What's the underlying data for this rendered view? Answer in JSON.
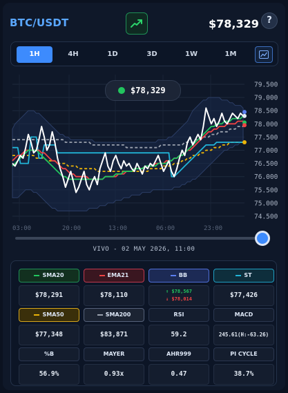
{
  "header": {
    "pair": "BTC/USDT",
    "price": "$78,329",
    "help": "?"
  },
  "timeframes": [
    "1H",
    "4H",
    "1D",
    "3D",
    "1W",
    "1M"
  ],
  "active_timeframe": "1H",
  "chart": {
    "pill_price": "$78,329",
    "live_label": "VIVO - 02 MAY 2026, 11:00"
  },
  "colors": {
    "price": "#ffffff",
    "sma20": "#22c55e",
    "ema21": "#ef4444",
    "sma50": "#eab308",
    "sma200": "#9ca3af",
    "supertrend": "#22b5d8",
    "bb_band": "#1a2a4a"
  },
  "chart_data": {
    "type": "line",
    "x_tick_labels": [
      "03:00",
      "20:00",
      "13:00",
      "06:00",
      "23:00"
    ],
    "y_tick_labels": [
      "79.500",
      "79.000",
      "78.500",
      "78.000",
      "77.500",
      "77.000",
      "76.500",
      "76.000",
      "75.500",
      "75.000",
      "74.500"
    ],
    "ylim": [
      74500,
      79500
    ],
    "grid": true,
    "series": [
      {
        "name": "",
        "color": "#ffffff",
        "values": [
          76.5,
          76.4,
          76.6,
          76.8,
          76.7,
          77.1,
          77.6,
          77.3,
          76.9,
          77.0,
          77.4,
          77.9,
          77.5,
          77.0,
          77.2,
          77.7,
          77.3,
          76.7,
          76.3,
          76.0,
          75.6,
          75.9,
          76.2,
          75.8,
          75.4,
          75.6,
          75.9,
          76.2,
          75.7,
          75.5,
          75.8,
          76.0,
          75.7,
          76.3,
          76.6,
          76.9,
          76.4,
          76.2,
          76.6,
          76.8,
          76.5,
          76.3,
          76.6,
          76.4,
          76.5,
          76.3,
          76.2,
          76.5,
          76.3,
          76.1,
          76.4,
          76.3,
          76.5,
          76.4,
          76.6,
          76.8,
          76.5,
          76.2,
          76.4,
          76.6,
          76.2,
          76.0,
          76.3,
          76.7,
          77.0,
          76.8,
          77.3,
          77.5,
          77.2,
          77.4,
          77.6,
          77.4,
          77.9,
          78.6,
          78.3,
          78.0,
          78.2,
          77.9,
          78.1,
          78.4,
          78.1,
          78.0,
          78.2,
          78.4,
          78.3,
          78.2,
          78.4,
          78.3
        ]
      },
      {
        "name": "",
        "color": "#22b5d8",
        "values": [
          77.1,
          77.1,
          77.1,
          76.5,
          76.5,
          76.5,
          76.5,
          77.5,
          77.5,
          77.5,
          76.7,
          76.7,
          77.2,
          77.2,
          77.2,
          77.2,
          77.2,
          76.9,
          76.9,
          76.9,
          76.9,
          76.9,
          76.9,
          76.9,
          76.9,
          76.9,
          76.9,
          76.9,
          76.9,
          76.9,
          76.9,
          76.9,
          76.9,
          76.9,
          76.9,
          76.9,
          76.9,
          76.9,
          76.9,
          76.9,
          76.9,
          76.9,
          76.9,
          76.9,
          76.9,
          76.9,
          76.9,
          76.9,
          76.9,
          76.9,
          76.9,
          76.9,
          76.9,
          76.9,
          76.9,
          76.9,
          76.9,
          76.9,
          76.9,
          76.9,
          76.0,
          76.0,
          76.1,
          76.2,
          76.3,
          76.4,
          76.5,
          76.6,
          76.7,
          76.8,
          76.9,
          77.0,
          77.1,
          77.2,
          77.2,
          77.2,
          77.2,
          77.3,
          77.3,
          77.3,
          77.3,
          77.3,
          77.3,
          77.3,
          77.3,
          77.3,
          77.3,
          77.3
        ]
      },
      {
        "name": "",
        "color": "#22c55e",
        "values": [
          76.4,
          76.5,
          76.6,
          76.7,
          76.8,
          76.9,
          77.0,
          77.0,
          77.0,
          77.0,
          76.9,
          76.8,
          76.7,
          76.6,
          76.5,
          76.4,
          76.3,
          76.2,
          76.1,
          76.0,
          76.0,
          75.9,
          75.9,
          75.9,
          75.9,
          75.9,
          75.9,
          75.9,
          75.9,
          75.9,
          75.9,
          75.9,
          75.9,
          75.9,
          75.9,
          76.0,
          76.0,
          76.0,
          76.0,
          76.1,
          76.1,
          76.1,
          76.2,
          76.2,
          76.2,
          76.2,
          76.3,
          76.3,
          76.3,
          76.3,
          76.4,
          76.4,
          76.4,
          76.4,
          76.4,
          76.5,
          76.5,
          76.5,
          76.5,
          76.6,
          76.6,
          76.7,
          76.7,
          76.8,
          76.8,
          76.9,
          77.0,
          77.1,
          77.2,
          77.3,
          77.4,
          77.5,
          77.6,
          77.7,
          77.8,
          77.9,
          77.9,
          78.0,
          78.0,
          78.0,
          78.1,
          78.1,
          78.1,
          78.2,
          78.2,
          78.2,
          78.2,
          78.3
        ]
      },
      {
        "name": "",
        "color": "#ef4444",
        "values": [
          76.6,
          76.7,
          76.8,
          76.8,
          76.9,
          77.0,
          77.0,
          77.0,
          77.0,
          77.0,
          77.0,
          76.9,
          76.9,
          76.8,
          76.7,
          76.6,
          76.6,
          76.5,
          76.4,
          76.3,
          76.3,
          76.2,
          76.1,
          76.1,
          76.0,
          76.0,
          76.0,
          76.0,
          76.0,
          75.9,
          75.9,
          75.9,
          75.9,
          75.9,
          75.9,
          76.0,
          76.0,
          76.0,
          76.0,
          76.0,
          76.1,
          76.1,
          76.1,
          76.2,
          76.2,
          76.2,
          76.3,
          76.3,
          76.3,
          76.3,
          76.4,
          76.4,
          76.4,
          76.4,
          76.5,
          76.5,
          76.5,
          76.5,
          76.6,
          76.6,
          76.6,
          76.7,
          76.7,
          76.8,
          76.8,
          76.9,
          77.0,
          77.0,
          77.1,
          77.2,
          77.3,
          77.4,
          77.5,
          77.6,
          77.7,
          77.7,
          77.8,
          77.8,
          77.9,
          77.9,
          77.9,
          78.0,
          78.0,
          78.0,
          78.0,
          78.1,
          78.1,
          78.1
        ]
      },
      {
        "name": "",
        "color": "#eab308",
        "dashed": true,
        "values": [
          76.8,
          76.8,
          76.8,
          76.8,
          76.8,
          76.8,
          76.8,
          76.8,
          76.8,
          76.7,
          76.7,
          76.7,
          76.7,
          76.6,
          76.6,
          76.6,
          76.6,
          76.5,
          76.5,
          76.5,
          76.5,
          76.4,
          76.4,
          76.4,
          76.4,
          76.3,
          76.3,
          76.3,
          76.3,
          76.3,
          76.3,
          76.3,
          76.2,
          76.2,
          76.2,
          76.2,
          76.2,
          76.2,
          76.2,
          76.2,
          76.2,
          76.2,
          76.2,
          76.2,
          76.2,
          76.2,
          76.2,
          76.2,
          76.2,
          76.2,
          76.2,
          76.2,
          76.3,
          76.3,
          76.3,
          76.3,
          76.3,
          76.4,
          76.4,
          76.4,
          76.4,
          76.5,
          76.5,
          76.5,
          76.6,
          76.6,
          76.7,
          76.7,
          76.8,
          76.8,
          76.8,
          76.9,
          76.9,
          77.0,
          77.0,
          77.0,
          77.1,
          77.1,
          77.1,
          77.2,
          77.2,
          77.2,
          77.3,
          77.3,
          77.3,
          77.3,
          77.3,
          77.3
        ]
      },
      {
        "name": "",
        "color": "#9ca3af",
        "dashed": true,
        "values": [
          77.4,
          77.4,
          77.4,
          77.4,
          77.4,
          77.4,
          77.4,
          77.4,
          77.4,
          77.4,
          77.4,
          77.4,
          77.4,
          77.4,
          77.4,
          77.4,
          77.4,
          77.4,
          77.4,
          77.4,
          77.3,
          77.3,
          77.3,
          77.3,
          77.3,
          77.3,
          77.3,
          77.3,
          77.3,
          77.3,
          77.2,
          77.2,
          77.2,
          77.2,
          77.2,
          77.2,
          77.2,
          77.2,
          77.2,
          77.2,
          77.2,
          77.2,
          77.2,
          77.1,
          77.1,
          77.1,
          77.1,
          77.1,
          77.1,
          77.1,
          77.1,
          77.1,
          77.1,
          77.1,
          77.1,
          77.1,
          77.2,
          77.2,
          77.2,
          77.2,
          77.2,
          77.2,
          77.2,
          77.2,
          77.2,
          77.3,
          77.3,
          77.3,
          77.3,
          77.4,
          77.4,
          77.4,
          77.5,
          77.5,
          77.5,
          77.6,
          77.6,
          77.6,
          77.7,
          77.7,
          77.7,
          77.7,
          77.8,
          77.8,
          77.8,
          77.9,
          77.9,
          77.9
        ]
      }
    ],
    "bb_upper": [
      77.8,
      78.0,
      78.1,
      78.2,
      78.3,
      78.4,
      78.5,
      78.5,
      78.5,
      78.4,
      78.4,
      78.3,
      78.2,
      78.1,
      78.0,
      77.9,
      77.8,
      77.7,
      77.6,
      77.6,
      77.5,
      77.5,
      77.4,
      77.4,
      77.4,
      77.4,
      77.4,
      77.4,
      77.4,
      77.4,
      77.4,
      77.3,
      77.3,
      77.3,
      77.3,
      77.3,
      77.3,
      77.3,
      77.3,
      77.3,
      77.3,
      77.3,
      77.3,
      77.3,
      77.3,
      77.3,
      77.3,
      77.3,
      77.3,
      77.3,
      77.3,
      77.3,
      77.3,
      77.3,
      77.3,
      77.4,
      77.4,
      77.4,
      77.4,
      77.5,
      77.5,
      77.6,
      77.7,
      77.8,
      77.9,
      78.0,
      78.1,
      78.3,
      78.5,
      78.6,
      78.7,
      78.8,
      78.9,
      78.9,
      79.0,
      79.0,
      79.0,
      79.0,
      79.0,
      78.9,
      78.9,
      78.9,
      78.8,
      78.8,
      78.7,
      78.7,
      78.7,
      78.6
    ],
    "bb_lower": [
      75.2,
      75.2,
      75.2,
      75.3,
      75.4,
      75.5,
      75.5,
      75.5,
      75.4,
      75.4,
      75.3,
      75.2,
      75.1,
      75.0,
      74.9,
      74.8,
      74.8,
      74.7,
      74.7,
      74.7,
      74.7,
      74.7,
      74.7,
      74.7,
      74.7,
      74.7,
      74.7,
      74.7,
      74.7,
      74.8,
      74.8,
      74.8,
      74.8,
      74.9,
      74.9,
      74.9,
      75.0,
      75.0,
      75.0,
      75.1,
      75.1,
      75.1,
      75.2,
      75.2,
      75.2,
      75.3,
      75.3,
      75.3,
      75.3,
      75.4,
      75.4,
      75.4,
      75.4,
      75.5,
      75.5,
      75.5,
      75.5,
      75.5,
      75.5,
      75.5,
      75.5,
      75.6,
      75.6,
      75.6,
      75.7,
      75.7,
      75.8,
      75.8,
      75.9,
      75.9,
      76.0,
      76.1,
      76.2,
      76.3,
      76.4,
      76.5,
      76.6,
      76.7,
      76.8,
      76.9,
      77.0,
      77.0,
      77.1,
      77.1,
      77.2,
      77.2,
      77.3,
      77.3
    ]
  },
  "indicators": [
    {
      "key": "sma20",
      "label": "SMA20",
      "value": "$78,291",
      "swatch": "#22c55e",
      "style": "h-sma20"
    },
    {
      "key": "ema21",
      "label": "EMA21",
      "value": "$78,110",
      "swatch": "#ef4444",
      "style": "h-ema21"
    },
    {
      "key": "bb",
      "label": "BB",
      "value_up": "↑ $78,567",
      "value_down": "↓ $78,014",
      "swatch": "#5b7ef0",
      "style": "h-bb"
    },
    {
      "key": "st",
      "label": "ST",
      "value": "$77,426",
      "swatch": "#22b5d8",
      "style": "h-st"
    },
    {
      "key": "sma50",
      "label": "SMA50",
      "value": "$77,348",
      "swatch": "#eab308",
      "style": "h-sma50"
    },
    {
      "key": "sma200",
      "label": "SMA200",
      "value": "$83,871",
      "swatch": "#9ca3af",
      "style": "h-sma200"
    },
    {
      "key": "rsi",
      "label": "RSI",
      "value": "59.2"
    },
    {
      "key": "macd",
      "label": "MACD",
      "value": "245.61(H:-63.26)"
    },
    {
      "key": "pctb",
      "label": "%B",
      "value": "56.9%"
    },
    {
      "key": "mayer",
      "label": "MAYER",
      "value": "0.93x"
    },
    {
      "key": "ahr999",
      "label": "AHR999",
      "value": "0.47"
    },
    {
      "key": "picycle",
      "label": "PI CYCLE",
      "value": "38.7%"
    }
  ]
}
